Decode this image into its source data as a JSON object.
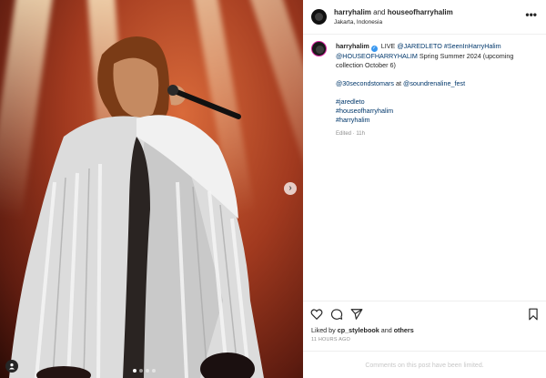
{
  "post": {
    "header": {
      "user1": "harryhalim",
      "and": "and",
      "user2": "houseofharryhalim",
      "location": "Jakarta, Indonesia",
      "more": "•••"
    },
    "caption": {
      "username": "harryhalim",
      "verified": "✓",
      "text1": "LIVE",
      "mention1": "@JAREDLETO",
      "hashtag1": "#SeenInHarryHalim",
      "mention2": "@HOUSEOFHARRYHALIM",
      "text2": "Spring Summer 2024 (upcoming collection October 6)",
      "mention3": "@30secondstomars",
      "text3": "at",
      "mention4": "@soundrenaline_fest",
      "tag_a": "#jaredleto",
      "tag_b": "#houseofharryhalim",
      "tag_c": "#harryhalim",
      "edited": "Edited · 11h"
    },
    "likes": {
      "prefix": "Liked by",
      "user": "cp_stylebook",
      "mid": "and",
      "others": "others"
    },
    "time_ago": "11 HOURS AGO",
    "comments_notice": "Comments on this post have been limited.",
    "icons": [
      "heart-icon",
      "comment-icon",
      "share-icon",
      "bookmark-icon",
      "more-icon",
      "user-tag-icon",
      "chevron-right-icon"
    ],
    "carousel": {
      "slides": 4,
      "active": 1
    }
  }
}
